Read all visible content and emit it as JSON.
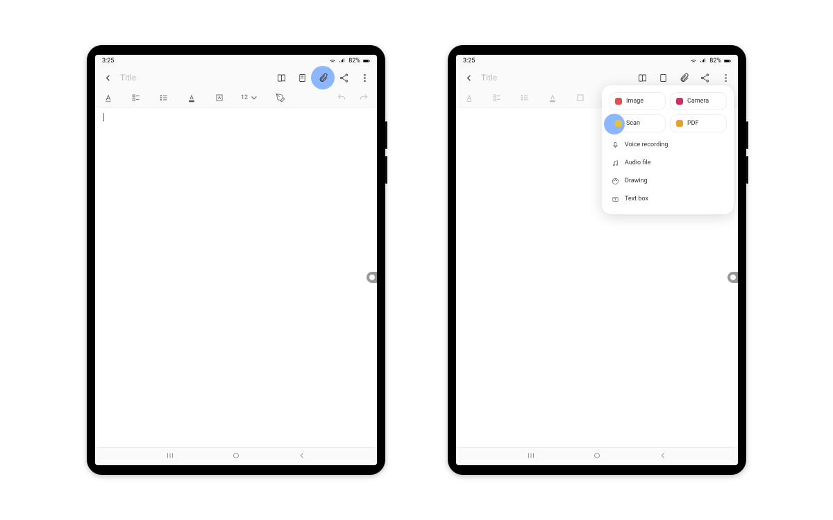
{
  "statusbar": {
    "time": "3:25",
    "battery": "82%"
  },
  "appbar": {
    "title_placeholder": "Title"
  },
  "toolbar": {
    "font_size": "12"
  },
  "navkeys": {
    "recent": "|||",
    "home": "○",
    "back": "<"
  },
  "attach_menu": {
    "cards": {
      "image": "Image",
      "camera": "Camera",
      "scan": "Scan",
      "pdf": "PDF"
    },
    "items": {
      "voice": "Voice recording",
      "audio": "Audio file",
      "drawing": "Drawing",
      "textbox": "Text box"
    }
  },
  "colors": {
    "image_icon": "#e05050",
    "camera_icon": "#d03060",
    "scan_icon": "#e6c040",
    "pdf_icon": "#e6a030"
  }
}
